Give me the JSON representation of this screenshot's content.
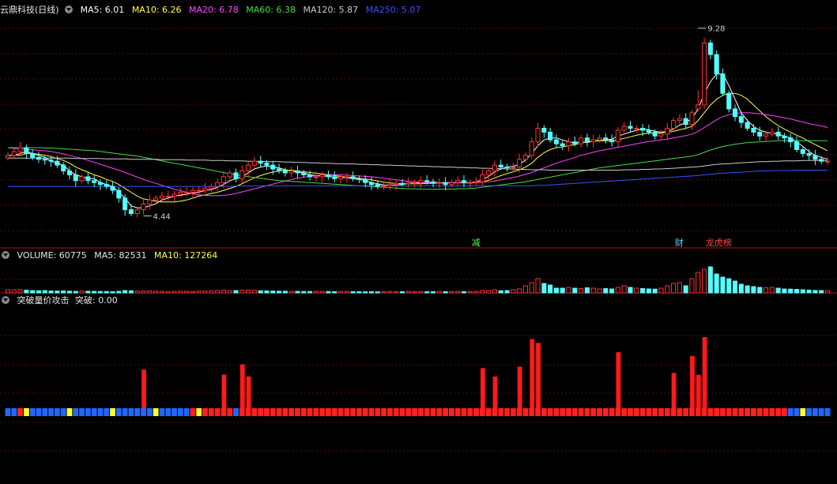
{
  "colors": {
    "up": "#ff3333",
    "down": "#54ffff",
    "ma5": "#ffffff",
    "ma10": "#ffff44",
    "ma20": "#ff44ff",
    "ma60": "#44dd44",
    "ma120": "#cccccc",
    "ma250": "#3355ff",
    "panel_border": "#b01010",
    "grid": "#5a0d0d"
  },
  "header": {
    "stock": "云鼎科技(日线)",
    "ma5": "MA5: 6.01",
    "ma10": "MA10: 6.26",
    "ma20": "MA20: 6.78",
    "ma60": "MA60: 6.38",
    "ma120": "MA120: 5.87",
    "ma250": "MA250: 5.07"
  },
  "volume_header": {
    "vol": "VOLUME: 60775",
    "ma5": "MA5: 82531",
    "ma10": "MA10: 127264"
  },
  "indicator_header": {
    "name": "突破量价攻击",
    "value": "突破: 0.00"
  },
  "chart_data": [
    {
      "type": "candlestick",
      "title": "云鼎科技(日线)",
      "ylim": [
        3.9,
        9.6
      ],
      "annotations": [
        {
          "label": "9.28",
          "x": 112,
          "y": 9.28
        },
        {
          "label": "4.44",
          "x": 22,
          "y": 4.44
        }
      ],
      "markers": [
        {
          "label": "减",
          "x": 76,
          "color": "#44ff44"
        },
        {
          "label": "财",
          "x": 109,
          "color": "#66ccff"
        },
        {
          "label": "龙虎榜",
          "x": 114,
          "color": "#ff4444"
        }
      ],
      "closes": [
        6.0,
        6.1,
        6.2,
        6.05,
        5.95,
        5.9,
        5.88,
        5.85,
        5.75,
        5.6,
        5.5,
        5.35,
        5.45,
        5.35,
        5.3,
        5.25,
        5.2,
        5.1,
        4.9,
        4.6,
        4.5,
        4.6,
        4.75,
        4.85,
        4.9,
        4.95,
        4.95,
        5.0,
        5.05,
        5.05,
        5.1,
        5.1,
        5.15,
        5.2,
        5.3,
        5.45,
        5.55,
        5.4,
        5.6,
        5.75,
        5.85,
        5.8,
        5.75,
        5.65,
        5.6,
        5.55,
        5.6,
        5.55,
        5.5,
        5.45,
        5.45,
        5.5,
        5.45,
        5.4,
        5.45,
        5.45,
        5.4,
        5.38,
        5.3,
        5.25,
        5.2,
        5.22,
        5.25,
        5.28,
        5.27,
        5.3,
        5.3,
        5.35,
        5.32,
        5.28,
        5.3,
        5.25,
        5.3,
        5.35,
        5.3,
        5.3,
        5.32,
        5.5,
        5.6,
        5.75,
        5.7,
        5.68,
        5.7,
        5.9,
        6.0,
        6.35,
        6.7,
        6.6,
        6.4,
        6.3,
        6.25,
        6.35,
        6.3,
        6.45,
        6.35,
        6.4,
        6.45,
        6.4,
        6.35,
        6.65,
        6.75,
        6.7,
        6.7,
        6.65,
        6.6,
        6.5,
        6.55,
        6.7,
        6.9,
        6.95,
        6.8,
        7.1,
        7.3,
        8.9,
        8.6,
        8.1,
        7.6,
        7.2,
        7.0,
        6.85,
        6.7,
        6.6,
        6.5,
        6.55,
        6.6,
        6.5,
        6.45,
        6.35,
        6.15,
        6.05,
        6.0,
        5.9,
        5.85,
        5.85
      ],
      "ma": {
        "MA5": [
          6.0,
          6.0,
          6.05,
          6.1,
          6.05,
          6.0,
          5.95,
          5.85,
          5.8,
          5.75,
          5.6,
          5.5,
          5.45,
          5.4,
          5.4,
          5.3,
          5.25,
          5.2,
          5.05,
          4.9,
          4.7,
          4.65,
          4.65,
          4.7,
          4.75,
          4.85,
          4.9,
          4.95,
          4.97,
          5.0,
          5.03,
          5.05,
          5.1,
          5.12,
          5.18,
          5.25,
          5.35,
          5.4,
          5.45,
          5.55,
          5.65,
          5.7,
          5.73,
          5.7,
          5.68,
          5.63,
          5.6,
          5.57,
          5.55,
          5.5,
          5.48,
          5.47,
          5.46,
          5.44,
          5.43,
          5.42,
          5.4,
          5.38,
          5.35,
          5.3,
          5.27,
          5.24,
          5.23,
          5.24,
          5.25,
          5.28,
          5.29,
          5.3,
          5.3,
          5.31,
          5.3,
          5.3,
          5.3,
          5.3,
          5.3,
          5.3,
          5.32,
          5.38,
          5.46,
          5.58,
          5.65,
          5.7,
          5.72,
          5.77,
          5.88,
          6.05,
          6.25,
          6.4,
          6.45,
          6.45,
          6.4,
          6.35,
          6.32,
          6.35,
          6.33,
          6.37,
          6.4,
          6.4,
          6.42,
          6.5,
          6.55,
          6.6,
          6.65,
          6.68,
          6.66,
          6.62,
          6.6,
          6.62,
          6.68,
          6.78,
          6.85,
          6.95,
          7.2,
          7.6,
          7.9,
          8.1,
          8.1,
          7.8,
          7.45,
          7.1,
          6.9,
          6.75,
          6.65,
          6.6,
          6.57,
          6.55,
          6.5,
          6.45,
          6.35,
          6.23,
          6.1,
          6.0,
          5.95,
          5.9
        ],
        "MA10": [
          6.0,
          6.0,
          6.0,
          6.05,
          6.05,
          6.03,
          6.0,
          5.97,
          5.92,
          5.87,
          5.8,
          5.7,
          5.63,
          5.57,
          5.5,
          5.45,
          5.38,
          5.33,
          5.25,
          5.15,
          5.05,
          4.95,
          4.88,
          4.85,
          4.82,
          4.8,
          4.8,
          4.8,
          4.82,
          4.85,
          4.9,
          4.95,
          4.98,
          5.02,
          5.05,
          5.1,
          5.15,
          5.2,
          5.27,
          5.35,
          5.42,
          5.48,
          5.53,
          5.57,
          5.6,
          5.62,
          5.62,
          5.6,
          5.58,
          5.56,
          5.54,
          5.52,
          5.5,
          5.48,
          5.46,
          5.44,
          5.43,
          5.41,
          5.39,
          5.37,
          5.34,
          5.31,
          5.29,
          5.28,
          5.27,
          5.27,
          5.27,
          5.27,
          5.28,
          5.28,
          5.29,
          5.29,
          5.3,
          5.3,
          5.3,
          5.3,
          5.3,
          5.32,
          5.36,
          5.42,
          5.48,
          5.53,
          5.58,
          5.63,
          5.7,
          5.8,
          5.95,
          6.07,
          6.15,
          6.2,
          6.22,
          6.25,
          6.28,
          6.32,
          6.35,
          6.37,
          6.38,
          6.38,
          6.38,
          6.4,
          6.44,
          6.48,
          6.52,
          6.55,
          6.57,
          6.58,
          6.58,
          6.6,
          6.62,
          6.66,
          6.7,
          6.75,
          6.9,
          7.1,
          7.3,
          7.45,
          7.55,
          7.6,
          7.6,
          7.55,
          7.45,
          7.3,
          7.15,
          7.0,
          6.88,
          6.77,
          6.68,
          6.6,
          6.52,
          6.45,
          6.36,
          6.28,
          6.2,
          6.12
        ],
        "MA20": [
          6.2,
          6.18,
          6.17,
          6.16,
          6.15,
          6.13,
          6.12,
          6.1,
          6.07,
          6.04,
          6.0,
          5.96,
          5.92,
          5.87,
          5.82,
          5.77,
          5.72,
          5.67,
          5.62,
          5.56,
          5.5,
          5.44,
          5.38,
          5.33,
          5.28,
          5.23,
          5.18,
          5.13,
          5.09,
          5.05,
          5.01,
          4.98,
          4.97,
          4.96,
          4.96,
          4.97,
          4.99,
          5.02,
          5.06,
          5.1,
          5.14,
          5.18,
          5.22,
          5.26,
          5.3,
          5.34,
          5.38,
          5.41,
          5.44,
          5.46,
          5.48,
          5.49,
          5.5,
          5.5,
          5.5,
          5.49,
          5.48,
          5.47,
          5.46,
          5.45,
          5.43,
          5.41,
          5.39,
          5.37,
          5.35,
          5.33,
          5.32,
          5.31,
          5.3,
          5.29,
          5.29,
          5.29,
          5.29,
          5.29,
          5.29,
          5.29,
          5.3,
          5.31,
          5.32,
          5.34,
          5.37,
          5.4,
          5.43,
          5.47,
          5.51,
          5.56,
          5.62,
          5.68,
          5.74,
          5.8,
          5.85,
          5.9,
          5.95,
          6.0,
          6.04,
          6.08,
          6.12,
          6.15,
          6.18,
          6.21,
          6.24,
          6.27,
          6.3,
          6.33,
          6.36,
          6.38,
          6.4,
          6.42,
          6.45,
          6.48,
          6.51,
          6.55,
          6.62,
          6.72,
          6.82,
          6.92,
          7.0,
          7.05,
          7.08,
          7.1,
          7.1,
          7.09,
          7.07,
          7.05,
          7.03,
          7.0,
          6.97,
          6.94,
          6.9,
          6.86,
          6.82,
          6.79,
          6.76,
          6.72
        ],
        "MA60": [
          6.2,
          6.2,
          6.2,
          6.2,
          6.2,
          6.2,
          6.19,
          6.19,
          6.18,
          6.17,
          6.16,
          6.15,
          6.14,
          6.13,
          6.12,
          6.1,
          6.08,
          6.06,
          6.04,
          6.02,
          6.0,
          5.98,
          5.95,
          5.92,
          5.89,
          5.86,
          5.83,
          5.8,
          5.77,
          5.74,
          5.71,
          5.68,
          5.65,
          5.62,
          5.59,
          5.56,
          5.53,
          5.5,
          5.47,
          5.45,
          5.43,
          5.41,
          5.39,
          5.37,
          5.35,
          5.34,
          5.33,
          5.32,
          5.31,
          5.3,
          5.29,
          5.28,
          5.27,
          5.26,
          5.25,
          5.24,
          5.23,
          5.22,
          5.21,
          5.2,
          5.19,
          5.18,
          5.17,
          5.16,
          5.15,
          5.14,
          5.14,
          5.13,
          5.13,
          5.13,
          5.13,
          5.13,
          5.13,
          5.14,
          5.14,
          5.15,
          5.16,
          5.18,
          5.2,
          5.22,
          5.24,
          5.26,
          5.28,
          5.3,
          5.32,
          5.35,
          5.38,
          5.41,
          5.44,
          5.47,
          5.5,
          5.53,
          5.56,
          5.59,
          5.62,
          5.65,
          5.68,
          5.7,
          5.72,
          5.74,
          5.76,
          5.78,
          5.8,
          5.82,
          5.84,
          5.86,
          5.88,
          5.9,
          5.92,
          5.94,
          5.96,
          5.98,
          6.02,
          6.08,
          6.14,
          6.19,
          6.23,
          6.26,
          6.29,
          6.31,
          6.33,
          6.34,
          6.35,
          6.36,
          6.37,
          6.38,
          6.38,
          6.38,
          6.38,
          6.38,
          6.38,
          6.38,
          6.38,
          6.38
        ],
        "MA120": [
          5.93,
          5.93,
          5.93,
          5.93,
          5.93,
          5.93,
          5.93,
          5.93,
          5.93,
          5.93,
          5.93,
          5.92,
          5.92,
          5.92,
          5.92,
          5.92,
          5.91,
          5.91,
          5.91,
          5.91,
          5.9,
          5.9,
          5.9,
          5.9,
          5.9,
          5.89,
          5.89,
          5.89,
          5.89,
          5.88,
          5.88,
          5.88,
          5.88,
          5.87,
          5.87,
          5.87,
          5.86,
          5.86,
          5.86,
          5.85,
          5.85,
          5.85,
          5.84,
          5.84,
          5.84,
          5.83,
          5.83,
          5.82,
          5.82,
          5.81,
          5.81,
          5.8,
          5.8,
          5.79,
          5.79,
          5.78,
          5.78,
          5.77,
          5.77,
          5.76,
          5.76,
          5.75,
          5.75,
          5.74,
          5.74,
          5.73,
          5.73,
          5.72,
          5.72,
          5.71,
          5.71,
          5.7,
          5.7,
          5.69,
          5.69,
          5.68,
          5.68,
          5.67,
          5.67,
          5.66,
          5.66,
          5.65,
          5.65,
          5.64,
          5.64,
          5.63,
          5.63,
          5.63,
          5.62,
          5.62,
          5.62,
          5.62,
          5.62,
          5.62,
          5.62,
          5.62,
          5.62,
          5.62,
          5.62,
          5.62,
          5.63,
          5.63,
          5.63,
          5.64,
          5.64,
          5.65,
          5.65,
          5.66,
          5.67,
          5.68,
          5.69,
          5.7,
          5.71,
          5.73,
          5.75,
          5.77,
          5.78,
          5.79,
          5.8,
          5.81,
          5.82,
          5.83,
          5.84,
          5.84,
          5.85,
          5.85,
          5.86,
          5.86,
          5.86,
          5.87,
          5.87,
          5.87,
          5.87,
          5.87
        ],
        "MA250": [
          5.2,
          5.2,
          5.2,
          5.2,
          5.2,
          5.2,
          5.2,
          5.2,
          5.2,
          5.2,
          5.2,
          5.2,
          5.2,
          5.2,
          5.2,
          5.2,
          5.2,
          5.2,
          5.2,
          5.2,
          5.2,
          5.2,
          5.2,
          5.2,
          5.2,
          5.2,
          5.2,
          5.2,
          5.2,
          5.2,
          5.2,
          5.2,
          5.2,
          5.2,
          5.2,
          5.2,
          5.2,
          5.21,
          5.21,
          5.21,
          5.22,
          5.22,
          5.22,
          5.22,
          5.22,
          5.22,
          5.22,
          5.22,
          5.22,
          5.22,
          5.22,
          5.22,
          5.22,
          5.22,
          5.22,
          5.22,
          5.22,
          5.22,
          5.22,
          5.22,
          5.22,
          5.22,
          5.22,
          5.22,
          5.22,
          5.22,
          5.22,
          5.22,
          5.22,
          5.22,
          5.22,
          5.22,
          5.22,
          5.22,
          5.22,
          5.22,
          5.22,
          5.22,
          5.22,
          5.22,
          5.22,
          5.22,
          5.22,
          5.22,
          5.22,
          5.22,
          5.23,
          5.23,
          5.24,
          5.25,
          5.26,
          5.27,
          5.28,
          5.29,
          5.3,
          5.31,
          5.32,
          5.33,
          5.34,
          5.35,
          5.36,
          5.37,
          5.38,
          5.39,
          5.4,
          5.41,
          5.42,
          5.43,
          5.44,
          5.45,
          5.46,
          5.47,
          5.48,
          5.5,
          5.51,
          5.53,
          5.54,
          5.55,
          5.56,
          5.57,
          5.58,
          5.59,
          5.6,
          5.6,
          5.61,
          5.61,
          5.61,
          5.61,
          5.62,
          5.62,
          5.62,
          5.62,
          5.62,
          5.62
        ]
      }
    },
    {
      "type": "bar",
      "title": "VOLUME",
      "values": [
        40,
        38,
        42,
        36,
        30,
        28,
        30,
        25,
        24,
        26,
        22,
        20,
        24,
        22,
        20,
        18,
        18,
        16,
        20,
        30,
        28,
        22,
        24,
        26,
        22,
        20,
        18,
        20,
        22,
        20,
        18,
        22,
        24,
        28,
        30,
        34,
        28,
        30,
        34,
        38,
        32,
        28,
        26,
        24,
        22,
        22,
        20,
        20,
        18,
        18,
        20,
        18,
        18,
        16,
        18,
        18,
        16,
        16,
        14,
        16,
        14,
        16,
        18,
        16,
        16,
        18,
        16,
        18,
        16,
        16,
        18,
        16,
        16,
        18,
        16,
        18,
        20,
        30,
        30,
        40,
        28,
        30,
        40,
        50,
        90,
        130,
        180,
        120,
        100,
        60,
        60,
        70,
        60,
        55,
        65,
        60,
        50,
        55,
        50,
        70,
        90,
        70,
        60,
        55,
        50,
        48,
        60,
        90,
        120,
        130,
        90,
        180,
        260,
        300,
        330,
        240,
        200,
        180,
        150,
        110,
        90,
        80,
        70,
        65,
        70,
        60,
        50,
        48,
        45,
        40,
        36,
        32,
        30,
        28
      ],
      "ma": {
        "MA5": 82531,
        "MA10": 127264
      }
    },
    {
      "type": "bar",
      "title": "突破量价攻击",
      "series": [
        {
          "name": "突破",
          "values": [
            0
          ]
        }
      ]
    }
  ]
}
